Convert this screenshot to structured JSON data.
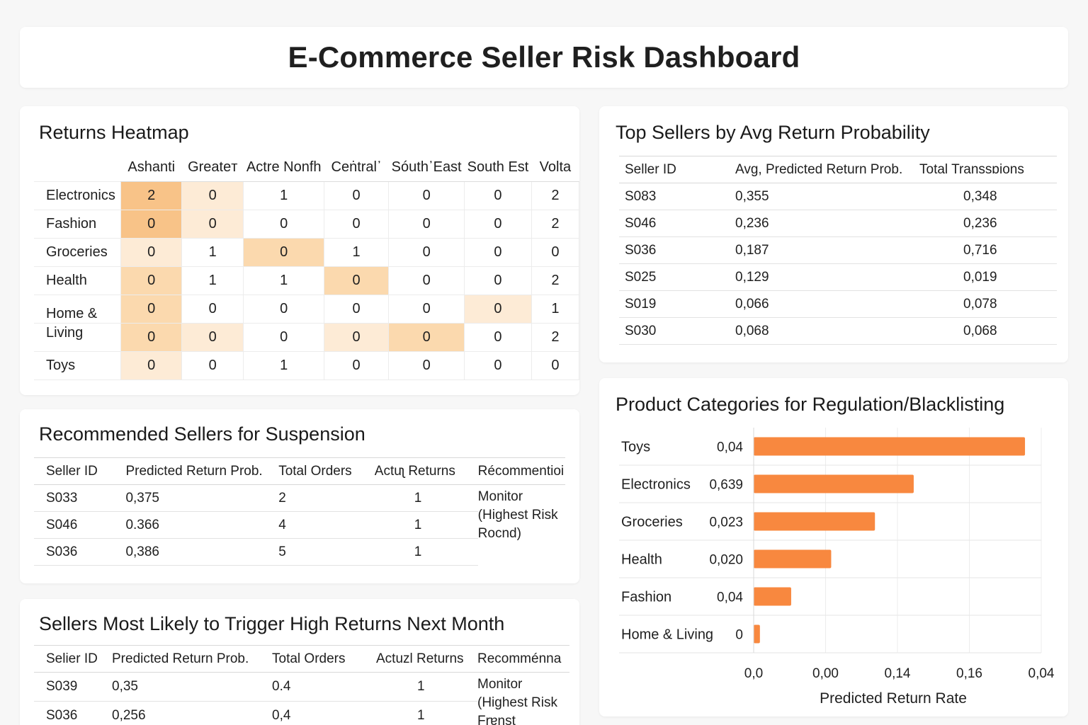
{
  "page_title": "E-Commerce Seller Risk Dashboard",
  "heatmap": {
    "title": "Returns Heatmap",
    "columns": [
      "Ashanti",
      "Greateᴛ",
      "Actre Nonfh",
      "Ceṅtral᾿",
      "Sóuth᾿East",
      "South Est",
      "Volta"
    ],
    "rows": [
      {
        "label": "Electronics",
        "values": [
          "2",
          "0",
          "1",
          "0",
          "0",
          "0",
          "2"
        ],
        "shade": [
          3,
          1,
          0,
          0,
          0,
          0,
          0
        ]
      },
      {
        "label": "Fashion",
        "values": [
          "0",
          "0",
          "0",
          "0",
          "0",
          "0",
          "2"
        ],
        "shade": [
          3,
          1,
          0,
          0,
          0,
          0,
          0
        ]
      },
      {
        "label": "Groceries",
        "values": [
          "0",
          "1",
          "0",
          "1",
          "0",
          "0",
          "0"
        ],
        "shade": [
          1,
          0,
          2,
          0,
          0,
          0,
          0
        ]
      },
      {
        "label": "Health",
        "values": [
          "0",
          "1",
          "1",
          "0",
          "0",
          "0",
          "2"
        ],
        "shade": [
          2,
          0,
          0,
          2,
          0,
          0,
          0
        ]
      },
      {
        "label": "Home &",
        "values": [
          "0",
          "0",
          "0",
          "0",
          "0",
          "0",
          "1"
        ],
        "shade": [
          2,
          0,
          0,
          0,
          0,
          1,
          0
        ]
      },
      {
        "label": "Living",
        "values": [
          "0",
          "0",
          "0",
          "0",
          "0",
          "0",
          "2"
        ],
        "shade": [
          2,
          1,
          0,
          1,
          2,
          0,
          0
        ]
      },
      {
        "label": "Toys",
        "values": [
          "0",
          "0",
          "1",
          "0",
          "0",
          "0",
          "0"
        ],
        "shade": [
          1,
          0,
          0,
          0,
          0,
          0,
          0
        ]
      }
    ],
    "colors": [
      "#ffffff",
      "#fdebd6",
      "#fbd9ae",
      "#f8c388"
    ]
  },
  "top_sellers": {
    "title": "Top Sellers by Avg Return Probability",
    "headers": [
      "Seller ID",
      "Avg, Predicted Return Prob.",
      "Total Transsɒions"
    ],
    "rows": [
      [
        "S083",
        "0,355",
        "0,348"
      ],
      [
        "S046",
        "0,236",
        "0,236"
      ],
      [
        "S036",
        "0,187",
        "0,716"
      ],
      [
        "S025",
        "0,129",
        "0,019"
      ],
      [
        "S019",
        "0,066",
        "0,078"
      ],
      [
        "S030",
        "0,068",
        "0,068"
      ]
    ]
  },
  "suspension": {
    "title": "Recommended Sellers for Suspension",
    "headers": [
      "Seller ID",
      "Predicted Return Prob.",
      "Total Orders",
      "Actuʅ Returns",
      "Récommentioi"
    ],
    "rows": [
      [
        "S033",
        "0,375",
        "2",
        "1"
      ],
      [
        "S046",
        "0.366",
        "4",
        "1"
      ],
      [
        "S036",
        "0,386",
        "5",
        "1"
      ]
    ],
    "recommendation": [
      "Monitor",
      "(Highest Risk",
      "Rocnd)"
    ]
  },
  "next_month": {
    "title": "Sellers Most Likely to Trigger High Returns Next Month",
    "headers": [
      "Selier ID",
      "Predicted Return Prob.",
      "Total  Orders",
      "Actuzl Returns",
      "Recomménna"
    ],
    "rows": [
      [
        "S039",
        "0,35",
        "0.4",
        "1"
      ],
      [
        "S036",
        "0,256",
        "0,4",
        "1"
      ]
    ],
    "recommendation": [
      "Monitor",
      "(Highest Risk",
      "Frɐnst"
    ]
  },
  "chart_data": {
    "type": "bar",
    "orientation": "horizontal",
    "title": "Product Categories for Regulation/Blacklisting",
    "xlabel": "Predicted Return Rate",
    "categories": [
      "Toys",
      "Electronics",
      "Groceries",
      "Health",
      "Fashion",
      "Home & Living"
    ],
    "value_labels": [
      "0,04",
      "0,639",
      "0,023",
      "0,020",
      "0,04",
      "0"
    ],
    "values": [
      0.217,
      0.128,
      0.097,
      0.062,
      0.03,
      0.005
    ],
    "xticks": [
      "0,0",
      "0,00",
      "0,14",
      "0,16",
      "0,04"
    ],
    "xlim": [
      0,
      0.23
    ],
    "grid": true,
    "bar_color": "#f8883f"
  }
}
